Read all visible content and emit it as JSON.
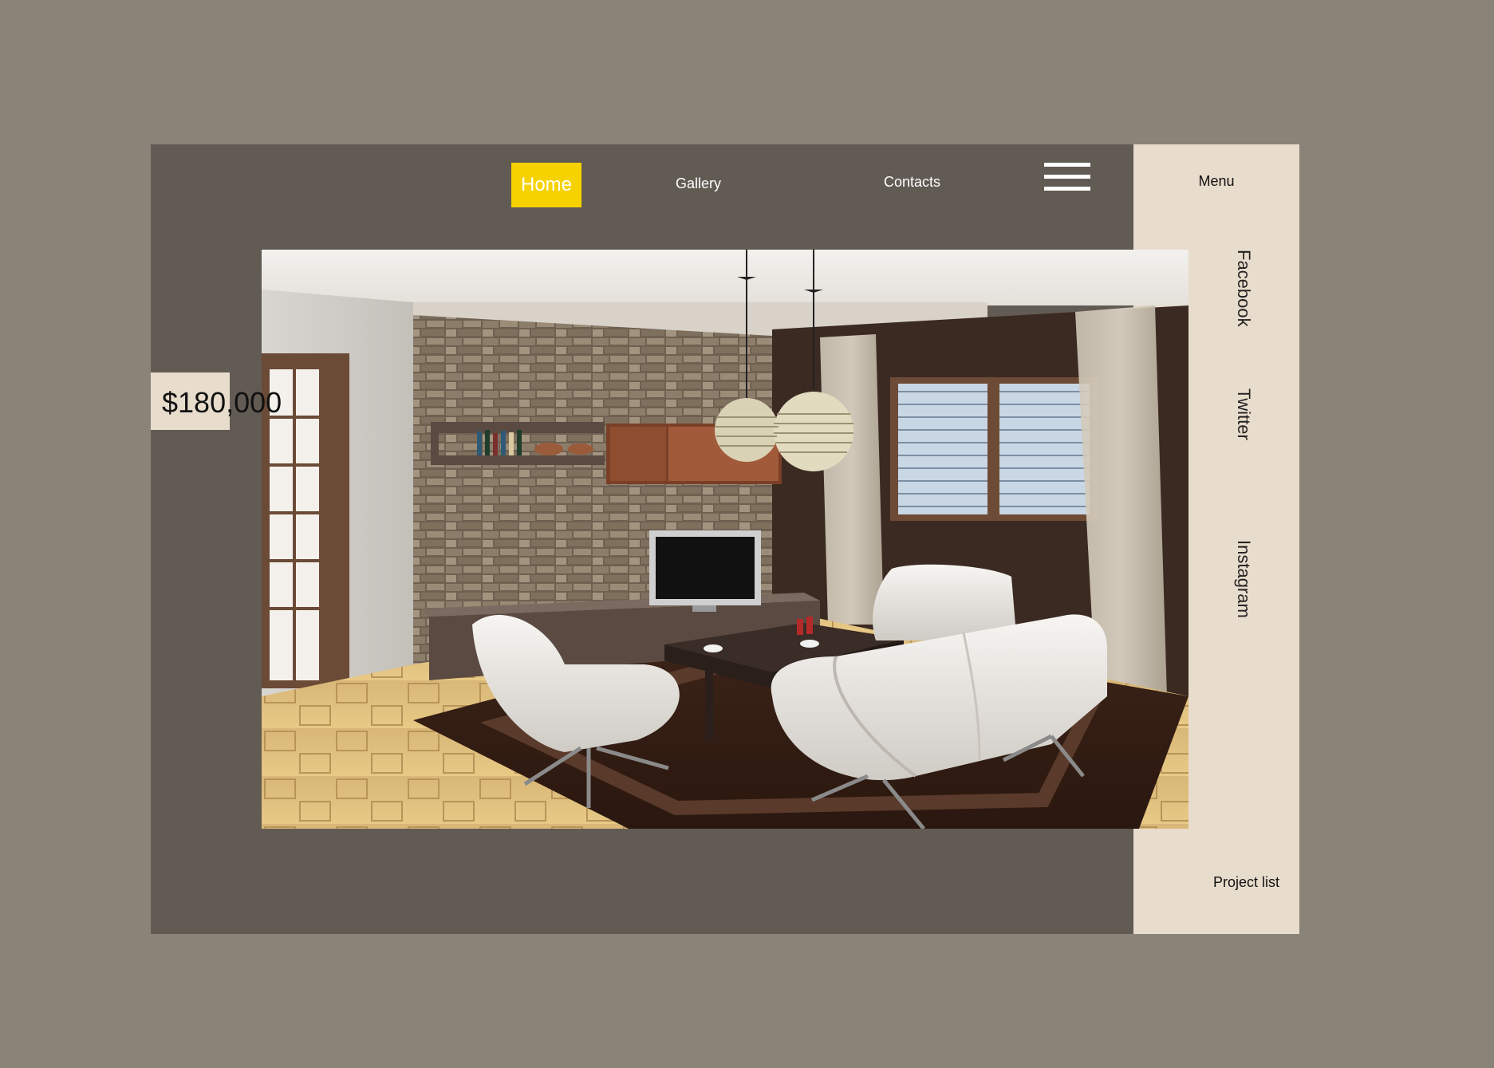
{
  "nav": {
    "home_label": "Home",
    "gallery_label": "Gallery",
    "contacts_label": "Contacts"
  },
  "sidebar": {
    "menu_label": "Menu",
    "social": [
      "Facebook",
      "Twitter",
      "Instagram"
    ],
    "project_list_label": "Project list"
  },
  "listing": {
    "price": "$180,000"
  },
  "colors": {
    "page_background": "#8a8378",
    "panel_dark": "#625b54",
    "panel_light": "#e8dccc",
    "accent_yellow": "#f6d200"
  },
  "icons": {
    "menu": "hamburger-icon"
  }
}
